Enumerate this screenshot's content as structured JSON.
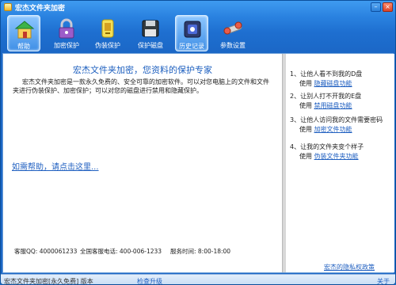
{
  "window": {
    "title": "宏杰文件夹加密",
    "minimize_glyph": "–",
    "close_glyph": "×"
  },
  "toolbar": {
    "items": [
      {
        "label": "帮助",
        "icon": "home-icon",
        "active": true
      },
      {
        "label": "加密保护",
        "icon": "lock-icon",
        "active": false
      },
      {
        "label": "伪装保护",
        "icon": "disguise-icon",
        "active": false
      },
      {
        "label": "保护磁盘",
        "icon": "disk-icon",
        "active": false
      },
      {
        "label": "历史记录",
        "icon": "history-icon",
        "active": true
      },
      {
        "label": "参数设置",
        "icon": "settings-icon",
        "active": false
      }
    ]
  },
  "main": {
    "headline": "宏杰文件夹加密，您资料的保护专家",
    "intro": "宏杰文件夹加密是一款永久免费的、安全可靠的加密软件。可以对您电脑上的文件和文件夹进行伪装保护、加密保护；可以对您的磁盘进行禁用和隐藏保护。",
    "help_link": "如需帮助，请点击这里...",
    "contact": {
      "qq": "客服QQ: 4000061233",
      "phone": "全国客服电话: 400-006-1233",
      "hours": "服务时间: 8:00-18:00"
    }
  },
  "features": [
    {
      "title": "1、让他人看不到我的D盘",
      "use": "使用",
      "link": "隐藏磁盘功能"
    },
    {
      "title": "2、让别人打不开我的E盘",
      "use": "使用",
      "link": "禁用磁盘功能"
    },
    {
      "title": "3、让他人访问我的文件需要密码",
      "use": "使用",
      "link": "加密文件功能"
    },
    {
      "title": "4、让我的文件夹变个样子",
      "use": "使用",
      "link": "伪装文件夹功能"
    }
  ],
  "privacy_link": "宏杰的隐私权政策",
  "statusbar": {
    "text": "宏杰文件夹加密[永久免费]  版本",
    "check_upgrade": "检查升级",
    "about": "关于"
  },
  "colors": {
    "accent": "#1f5fc0",
    "toolbar_bg": "#2a82e0"
  }
}
